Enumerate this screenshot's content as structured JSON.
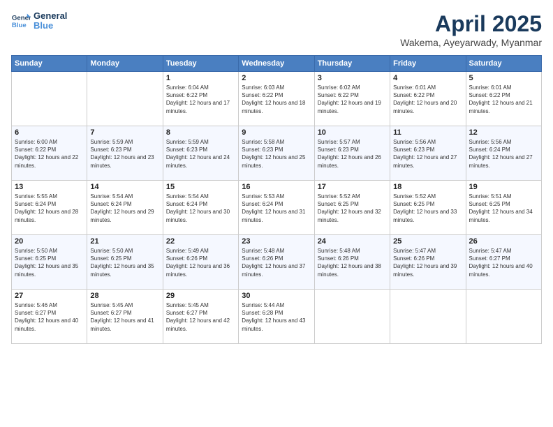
{
  "logo": {
    "line1": "General",
    "line2": "Blue"
  },
  "title": "April 2025",
  "location": "Wakema, Ayeyarwady, Myanmar",
  "weekdays": [
    "Sunday",
    "Monday",
    "Tuesday",
    "Wednesday",
    "Thursday",
    "Friday",
    "Saturday"
  ],
  "weeks": [
    [
      {
        "day": "",
        "info": ""
      },
      {
        "day": "",
        "info": ""
      },
      {
        "day": "1",
        "info": "Sunrise: 6:04 AM\nSunset: 6:22 PM\nDaylight: 12 hours and 17 minutes."
      },
      {
        "day": "2",
        "info": "Sunrise: 6:03 AM\nSunset: 6:22 PM\nDaylight: 12 hours and 18 minutes."
      },
      {
        "day": "3",
        "info": "Sunrise: 6:02 AM\nSunset: 6:22 PM\nDaylight: 12 hours and 19 minutes."
      },
      {
        "day": "4",
        "info": "Sunrise: 6:01 AM\nSunset: 6:22 PM\nDaylight: 12 hours and 20 minutes."
      },
      {
        "day": "5",
        "info": "Sunrise: 6:01 AM\nSunset: 6:22 PM\nDaylight: 12 hours and 21 minutes."
      }
    ],
    [
      {
        "day": "6",
        "info": "Sunrise: 6:00 AM\nSunset: 6:22 PM\nDaylight: 12 hours and 22 minutes."
      },
      {
        "day": "7",
        "info": "Sunrise: 5:59 AM\nSunset: 6:23 PM\nDaylight: 12 hours and 23 minutes."
      },
      {
        "day": "8",
        "info": "Sunrise: 5:59 AM\nSunset: 6:23 PM\nDaylight: 12 hours and 24 minutes."
      },
      {
        "day": "9",
        "info": "Sunrise: 5:58 AM\nSunset: 6:23 PM\nDaylight: 12 hours and 25 minutes."
      },
      {
        "day": "10",
        "info": "Sunrise: 5:57 AM\nSunset: 6:23 PM\nDaylight: 12 hours and 26 minutes."
      },
      {
        "day": "11",
        "info": "Sunrise: 5:56 AM\nSunset: 6:23 PM\nDaylight: 12 hours and 27 minutes."
      },
      {
        "day": "12",
        "info": "Sunrise: 5:56 AM\nSunset: 6:24 PM\nDaylight: 12 hours and 27 minutes."
      }
    ],
    [
      {
        "day": "13",
        "info": "Sunrise: 5:55 AM\nSunset: 6:24 PM\nDaylight: 12 hours and 28 minutes."
      },
      {
        "day": "14",
        "info": "Sunrise: 5:54 AM\nSunset: 6:24 PM\nDaylight: 12 hours and 29 minutes."
      },
      {
        "day": "15",
        "info": "Sunrise: 5:54 AM\nSunset: 6:24 PM\nDaylight: 12 hours and 30 minutes."
      },
      {
        "day": "16",
        "info": "Sunrise: 5:53 AM\nSunset: 6:24 PM\nDaylight: 12 hours and 31 minutes."
      },
      {
        "day": "17",
        "info": "Sunrise: 5:52 AM\nSunset: 6:25 PM\nDaylight: 12 hours and 32 minutes."
      },
      {
        "day": "18",
        "info": "Sunrise: 5:52 AM\nSunset: 6:25 PM\nDaylight: 12 hours and 33 minutes."
      },
      {
        "day": "19",
        "info": "Sunrise: 5:51 AM\nSunset: 6:25 PM\nDaylight: 12 hours and 34 minutes."
      }
    ],
    [
      {
        "day": "20",
        "info": "Sunrise: 5:50 AM\nSunset: 6:25 PM\nDaylight: 12 hours and 35 minutes."
      },
      {
        "day": "21",
        "info": "Sunrise: 5:50 AM\nSunset: 6:25 PM\nDaylight: 12 hours and 35 minutes."
      },
      {
        "day": "22",
        "info": "Sunrise: 5:49 AM\nSunset: 6:26 PM\nDaylight: 12 hours and 36 minutes."
      },
      {
        "day": "23",
        "info": "Sunrise: 5:48 AM\nSunset: 6:26 PM\nDaylight: 12 hours and 37 minutes."
      },
      {
        "day": "24",
        "info": "Sunrise: 5:48 AM\nSunset: 6:26 PM\nDaylight: 12 hours and 38 minutes."
      },
      {
        "day": "25",
        "info": "Sunrise: 5:47 AM\nSunset: 6:26 PM\nDaylight: 12 hours and 39 minutes."
      },
      {
        "day": "26",
        "info": "Sunrise: 5:47 AM\nSunset: 6:27 PM\nDaylight: 12 hours and 40 minutes."
      }
    ],
    [
      {
        "day": "27",
        "info": "Sunrise: 5:46 AM\nSunset: 6:27 PM\nDaylight: 12 hours and 40 minutes."
      },
      {
        "day": "28",
        "info": "Sunrise: 5:45 AM\nSunset: 6:27 PM\nDaylight: 12 hours and 41 minutes."
      },
      {
        "day": "29",
        "info": "Sunrise: 5:45 AM\nSunset: 6:27 PM\nDaylight: 12 hours and 42 minutes."
      },
      {
        "day": "30",
        "info": "Sunrise: 5:44 AM\nSunset: 6:28 PM\nDaylight: 12 hours and 43 minutes."
      },
      {
        "day": "",
        "info": ""
      },
      {
        "day": "",
        "info": ""
      },
      {
        "day": "",
        "info": ""
      }
    ]
  ]
}
